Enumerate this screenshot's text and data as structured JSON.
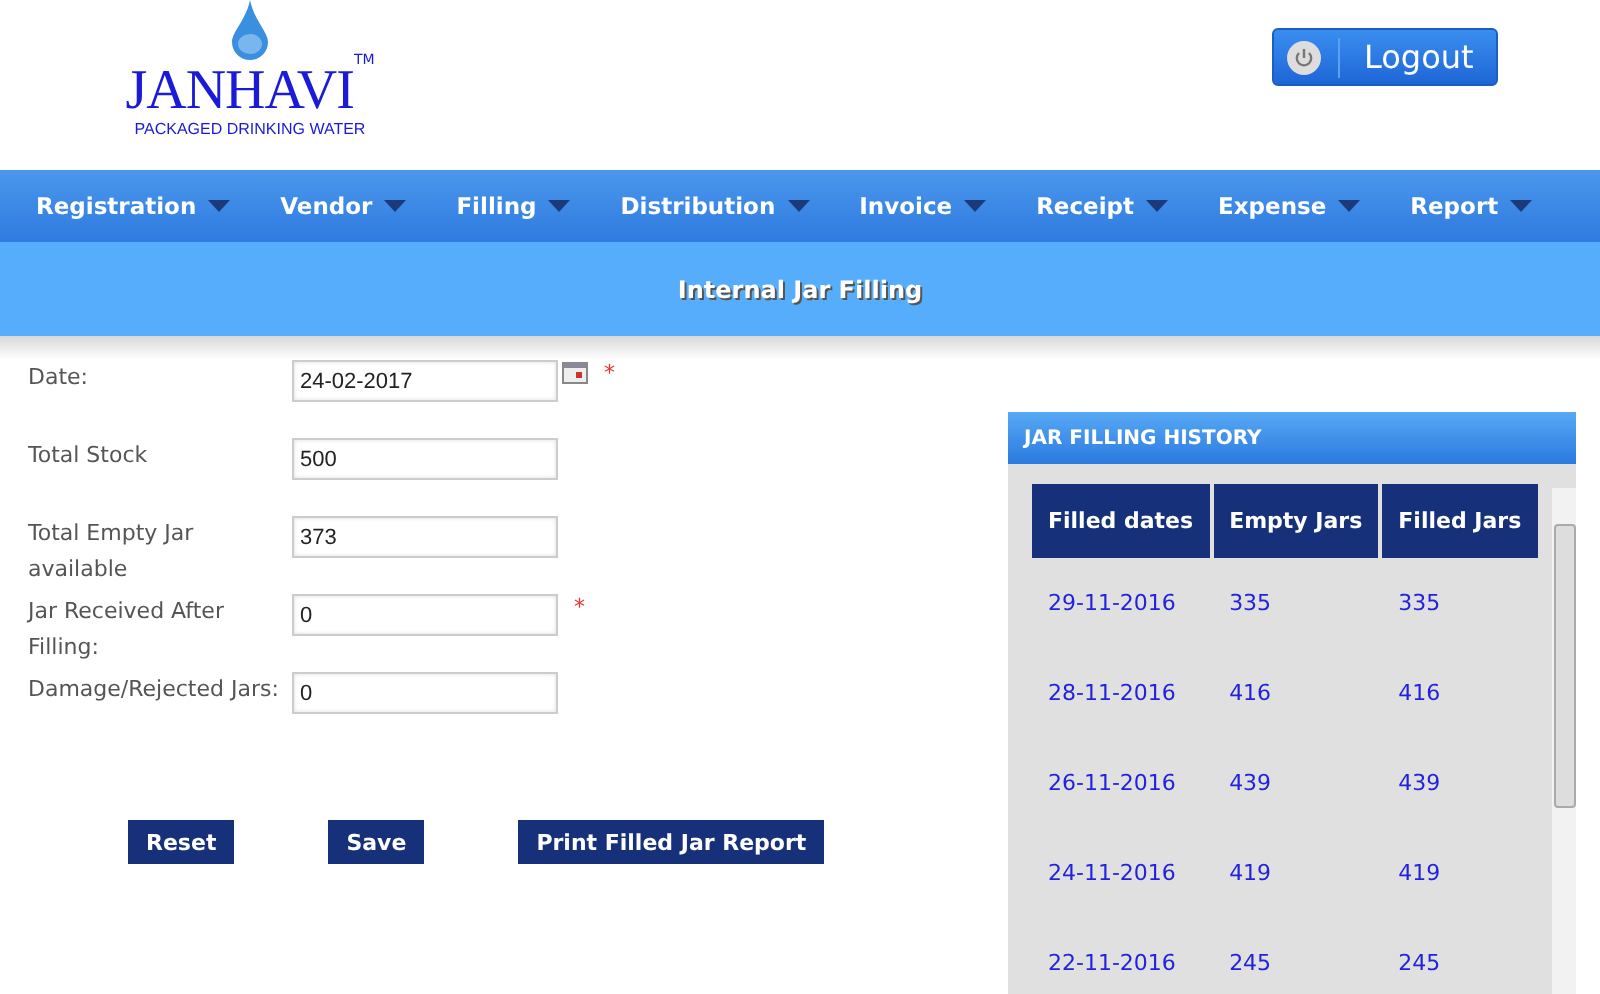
{
  "logo": {
    "brand": "JANHAVI",
    "trademark": "TM",
    "tagline": "PACKAGED DRINKING WATER"
  },
  "logout": {
    "label": "Logout"
  },
  "nav": [
    "Registration",
    "Vendor",
    "Filling",
    "Distribution",
    "Invoice",
    "Receipt",
    "Expense",
    "Report"
  ],
  "page_title": "Internal Jar Filling",
  "form": {
    "fields": [
      {
        "label": "Date:",
        "value": "24-02-2017",
        "required": true,
        "calendar": true
      },
      {
        "label": "Total Stock",
        "value": "500",
        "required": false,
        "calendar": false
      },
      {
        "label": "Total Empty Jar available",
        "value": "373",
        "required": false,
        "calendar": false
      },
      {
        "label": "Jar Received After Filling:",
        "value": "0",
        "required": true,
        "calendar": false
      },
      {
        "label": "Damage/Rejected Jars:",
        "value": "0",
        "required": false,
        "calendar": false
      }
    ],
    "required_mark": "*",
    "buttons": [
      "Reset",
      "Save",
      "Print Filled Jar Report"
    ]
  },
  "history": {
    "title": "JAR FILLING HISTORY",
    "columns": [
      "Filled dates",
      "Empty Jars",
      "Filled Jars"
    ],
    "rows": [
      [
        "29-11-2016",
        "335",
        "335"
      ],
      [
        "28-11-2016",
        "416",
        "416"
      ],
      [
        "26-11-2016",
        "439",
        "439"
      ],
      [
        "24-11-2016",
        "419",
        "419"
      ],
      [
        "22-11-2016",
        "245",
        "245"
      ]
    ]
  }
}
